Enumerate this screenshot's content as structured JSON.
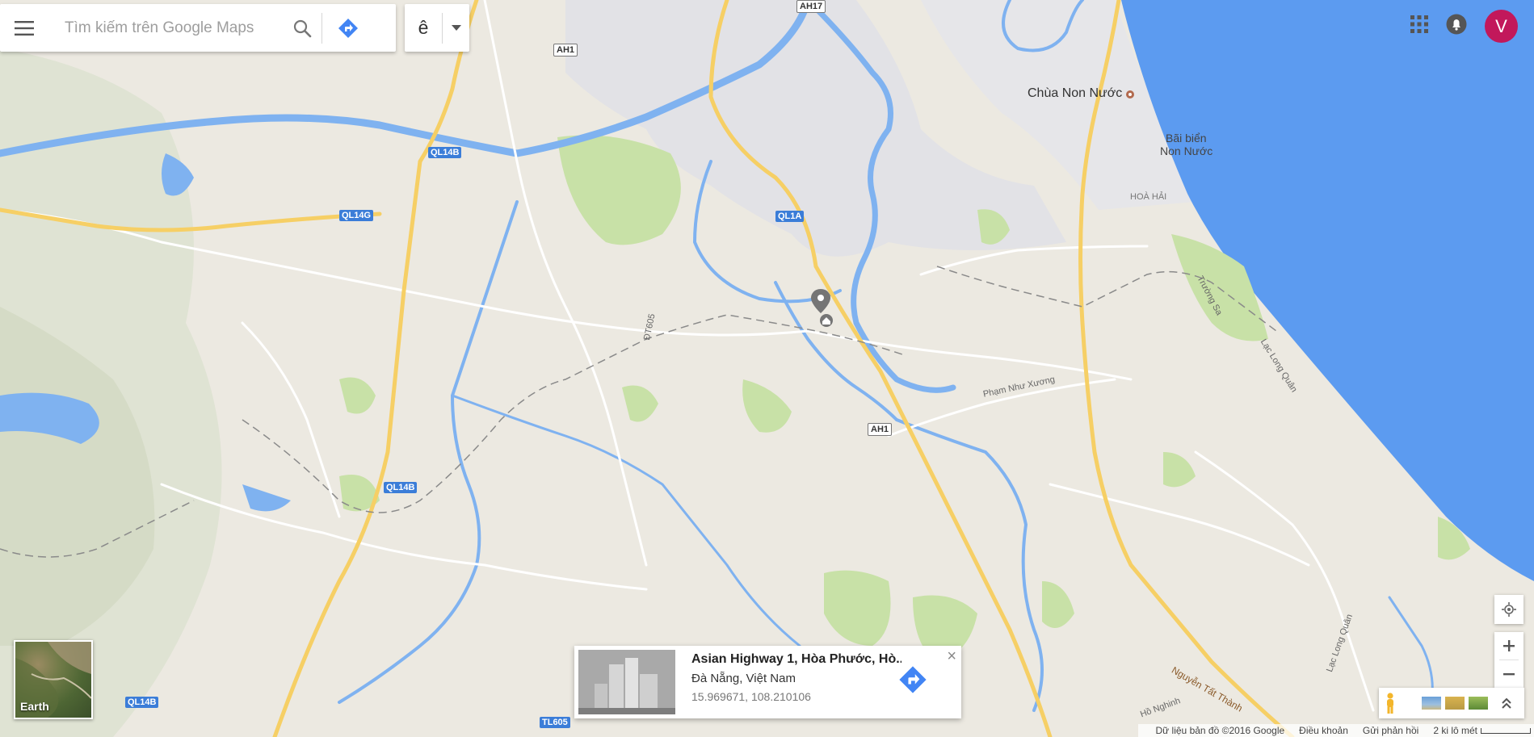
{
  "search": {
    "placeholder": "Tìm kiếm trên Google Maps"
  },
  "ime": {
    "char": "ê"
  },
  "account": {
    "initial": "V",
    "color": "#c2185b"
  },
  "earth": {
    "label": "Earth"
  },
  "info_card": {
    "title": "Asian Highway 1, Hòa Phước, Hò...",
    "address": "Đà Nẵng, Việt Nam",
    "coords": "15.969671, 108.210106"
  },
  "map_labels": {
    "poi_chua": "Chùa Non Nước",
    "beach_line1": "Bãi biển",
    "beach_line2": "Non Nước",
    "hoa_hai": "HOÀ HẢI",
    "truong_sa": "Trường Sa",
    "lac_long_quan_1": "Lạc Long Quân",
    "lac_long_quan_2": "Lạc Long Quân",
    "pham_nhu_xuong": "Phạm Như Xương",
    "nguyen_tat_thanh": "Nguyễn Tất Thành",
    "ho_nghinh": "Hồ Nghinh",
    "dt605": "ĐT605"
  },
  "road_shields": {
    "ah17": "AH17",
    "ah1_top": "AH1",
    "ah1_mid": "AH1",
    "ql14b_1": "QL14B",
    "ql14g": "QL14G",
    "ql1a": "QL1A",
    "ql14b_2": "QL14B",
    "ql14b_3": "QL14B",
    "tl605": "TL605"
  },
  "footer": {
    "data": "Dữ liệu bản đồ ©2016 Google",
    "terms": "Điều khoản",
    "feedback": "Gửi phản hồi",
    "scale": "2 ki lô mét"
  },
  "colors": {
    "land": "#ece9e1",
    "water": "#7fb2f0",
    "sea": "#5c9bf0",
    "highway": "#f6cf65",
    "park": "#c8e1a7",
    "urban": "#e2e2e6",
    "accent_blue": "#4285f4"
  }
}
